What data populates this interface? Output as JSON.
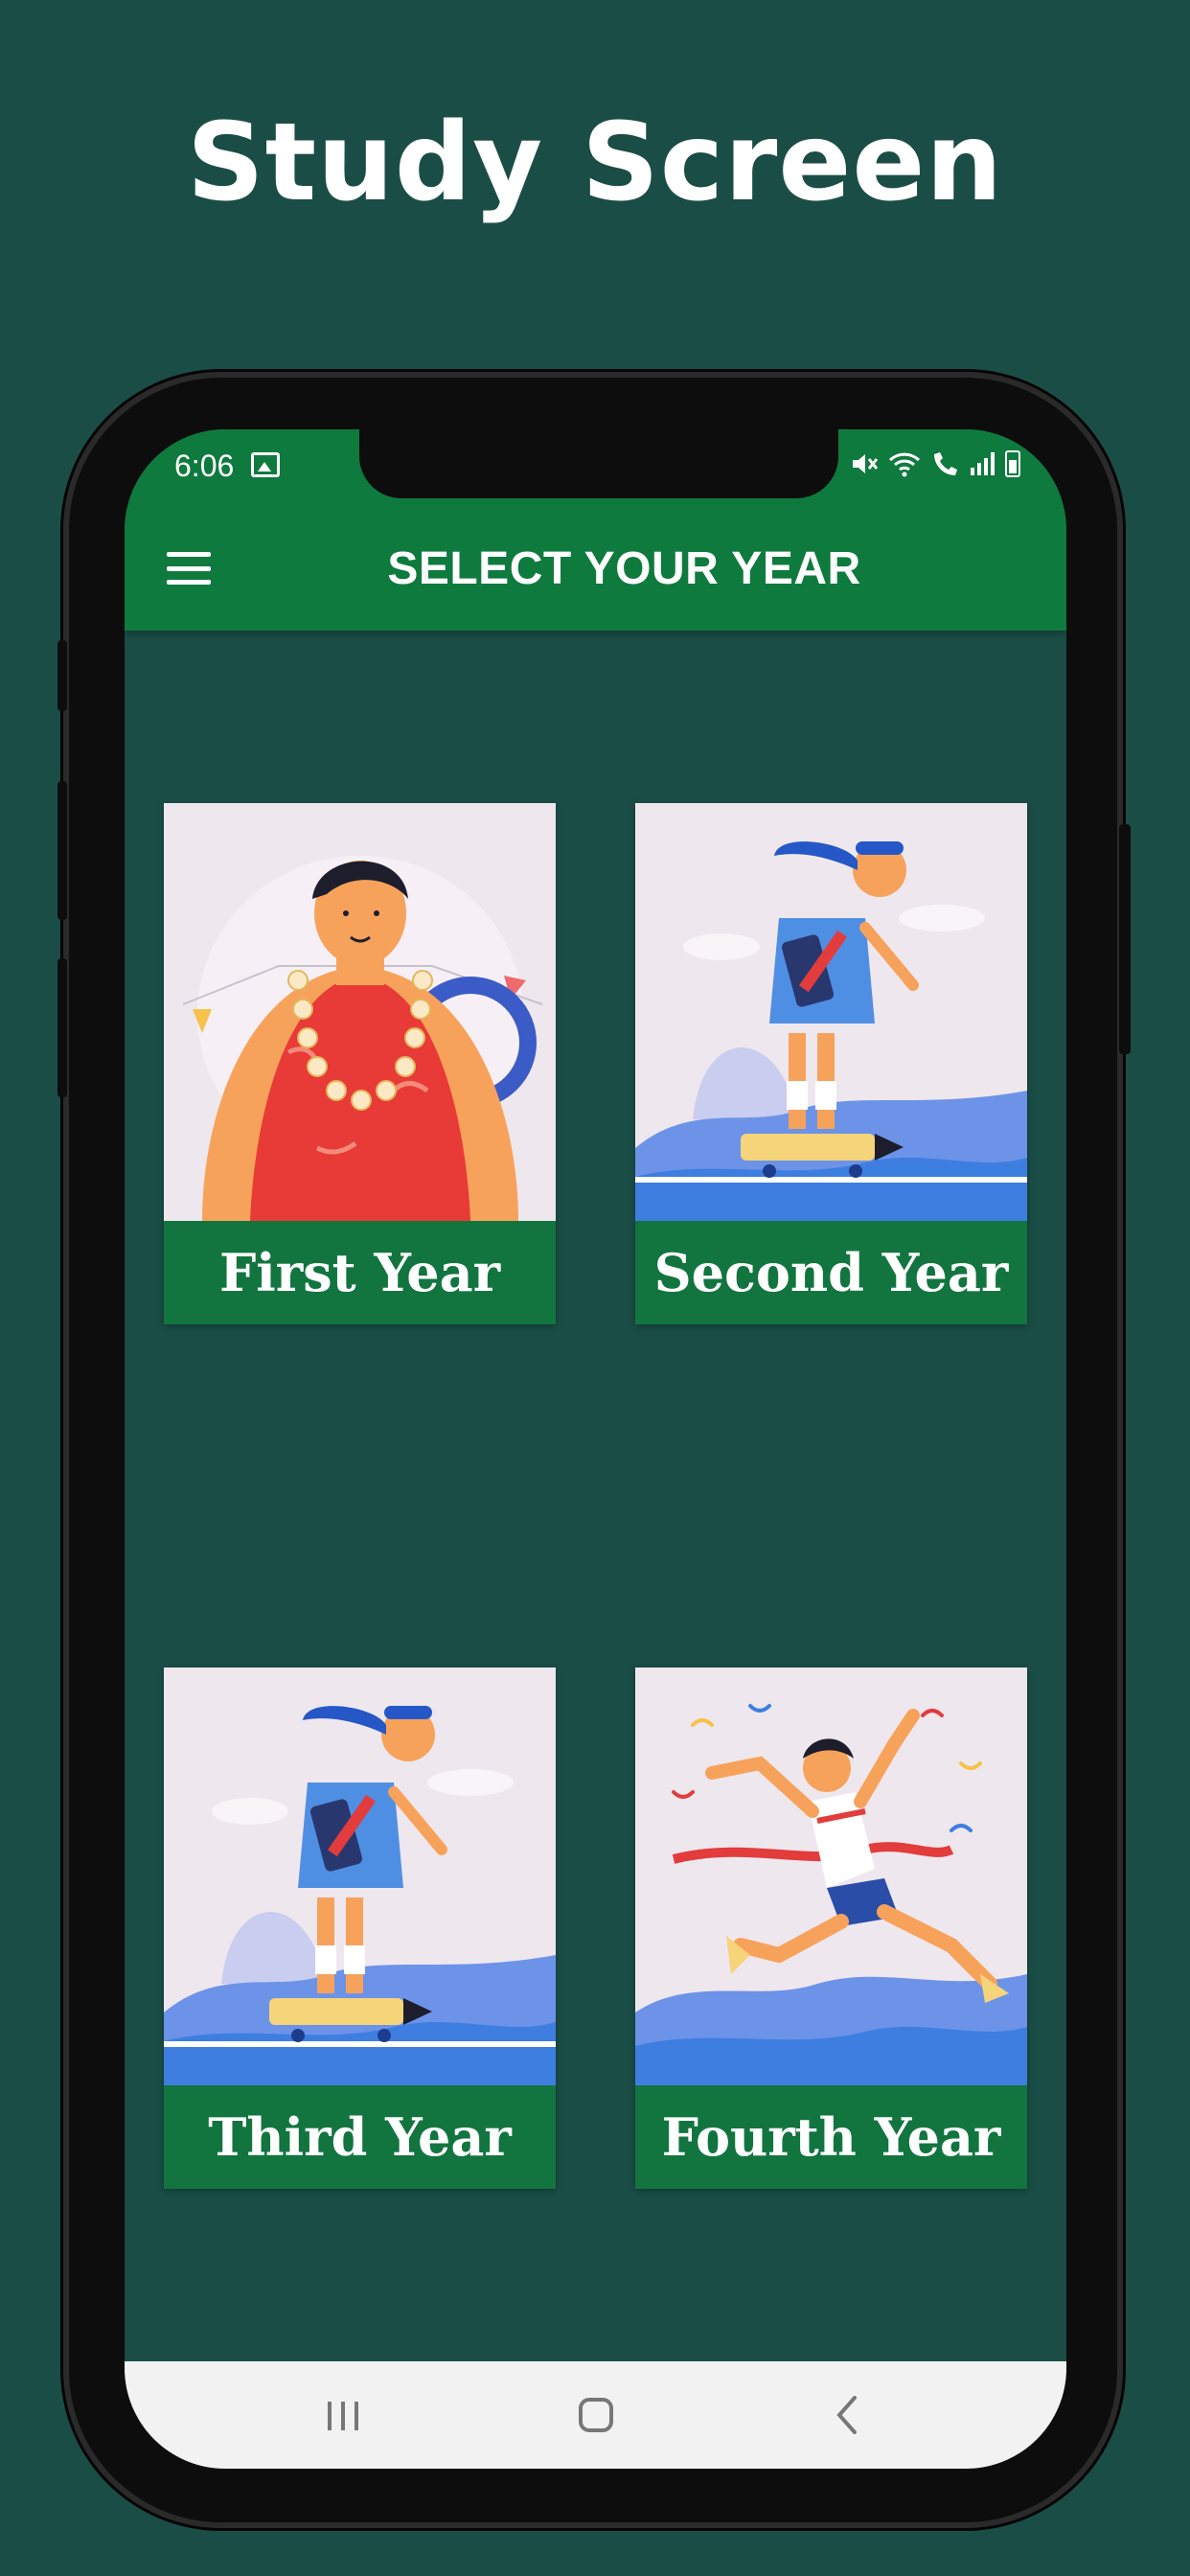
{
  "promo": {
    "title": "Study Screen"
  },
  "status_bar": {
    "time": "6:06",
    "icons": [
      "image-icon",
      "mute-icon",
      "wifi-icon",
      "wifi-call-icon",
      "signal-icon",
      "battery-icon"
    ]
  },
  "app_bar": {
    "title": "SELECT YOUR YEAR",
    "menu_icon": "hamburger-menu-icon"
  },
  "cards": [
    {
      "label": "First Year"
    },
    {
      "label": "Second Year"
    },
    {
      "label": "Third Year"
    },
    {
      "label": "Fourth Year"
    }
  ],
  "nav_bar": {
    "buttons": [
      "recents-icon",
      "home-icon",
      "back-icon"
    ]
  },
  "colors": {
    "background": "#1b4d47",
    "app_bar": "#0f7a3e",
    "card_label": "#12753f",
    "card_art": "#efe7ee"
  }
}
